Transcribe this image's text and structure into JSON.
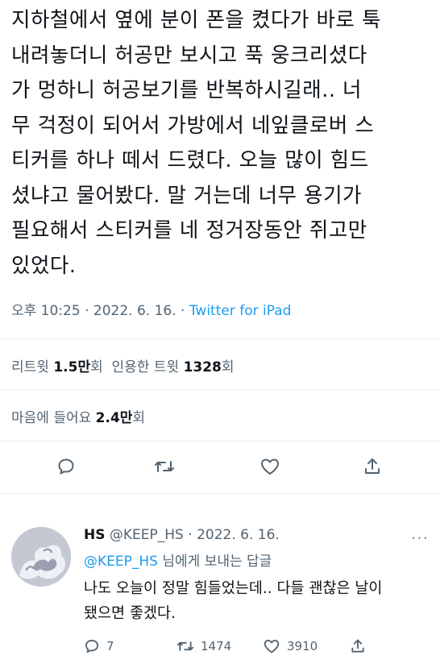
{
  "tweet": {
    "lines": [
      "지하철에서 옆에 분이 폰을 켰다가 바로 툭",
      "내려놓더니 허공만 보시고 푹 웅크리셨다",
      "가 멍하니 허공보기를 반복하시길래.. 너",
      "무 걱정이 되어서 가방에서 네잎클로버 스",
      "티커를 하나 떼서 드렸다. 오늘 많이 힘드",
      "셨냐고 물어봤다. 말 거는데 너무 용기가",
      "필요해서 스티커를 네 정거장동안 쥐고만",
      "있었다."
    ],
    "time": "오후 10:25",
    "sep": " · ",
    "date": "2022. 6. 16.",
    "source": "Twitter for iPad"
  },
  "stats": {
    "retweets_label": "리트윗",
    "retweets_count": "1.5만",
    "retweets_unit": "회",
    "quotes_label": "인용한 트윗",
    "quotes_count": "1328",
    "quotes_unit": "회",
    "likes_label": "마음에 들어요",
    "likes_count": "2.4만",
    "likes_unit": "회"
  },
  "actions": {
    "icons": [
      "reply-icon",
      "retweet-icon",
      "like-icon",
      "share-icon"
    ]
  },
  "reply": {
    "name": "HS",
    "handle": "@KEEP_HS",
    "sep": " · ",
    "date": "2022. 6. 16.",
    "more": "···",
    "replying_to_handle": "@KEEP_HS",
    "replying_to_suffix": " 님에게 보내는 답글",
    "text_lines": [
      "나도 오늘이 정말 힘들었는데.. 다들 괜찮은 날이",
      "됐으면 좋겠다."
    ],
    "reply_count": "7",
    "retweet_count": "1474",
    "like_count": "3910"
  },
  "colors": {
    "text": "#0f1419",
    "secondary": "#536471",
    "accent": "#1d9bf0",
    "divider": "#e6ecf0"
  }
}
